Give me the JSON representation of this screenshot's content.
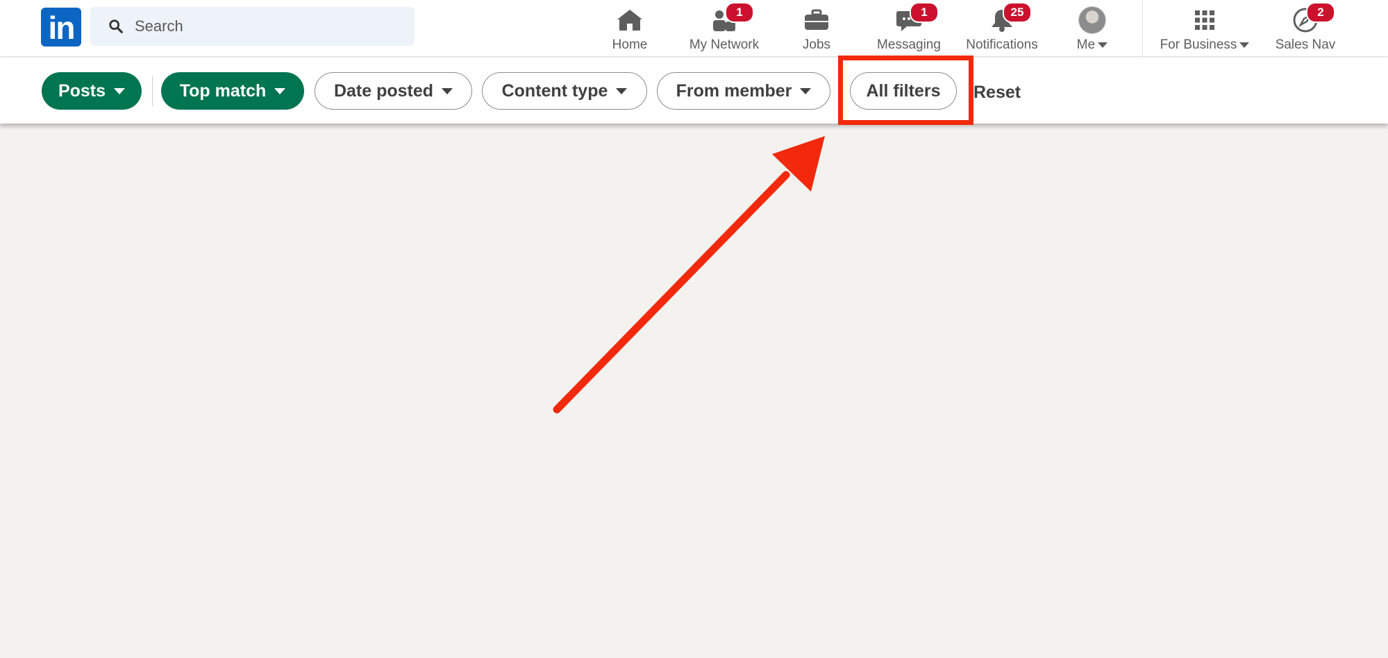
{
  "search": {
    "placeholder": "Search"
  },
  "logo": {
    "text": "in"
  },
  "nav": {
    "home": {
      "label": "Home"
    },
    "network": {
      "label": "My Network",
      "badge": "1"
    },
    "jobs": {
      "label": "Jobs"
    },
    "messaging": {
      "label": "Messaging",
      "badge": "1"
    },
    "notifications": {
      "label": "Notifications",
      "badge": "25"
    },
    "me": {
      "label": "Me"
    },
    "business": {
      "label": "For Business"
    },
    "salesnav": {
      "label": "Sales Nav",
      "badge": "2"
    }
  },
  "filters": {
    "posts": "Posts",
    "top_match": "Top match",
    "date_posted": "Date posted",
    "content_type": "Content type",
    "from_member": "From member",
    "all_filters": "All filters",
    "reset": "Reset"
  },
  "colors": {
    "brand": "#0a66c2",
    "filter_green": "#01754f",
    "badge_red": "#cb112d",
    "annotation_red": "#f2290c",
    "page_bg": "#f3f2ef"
  }
}
